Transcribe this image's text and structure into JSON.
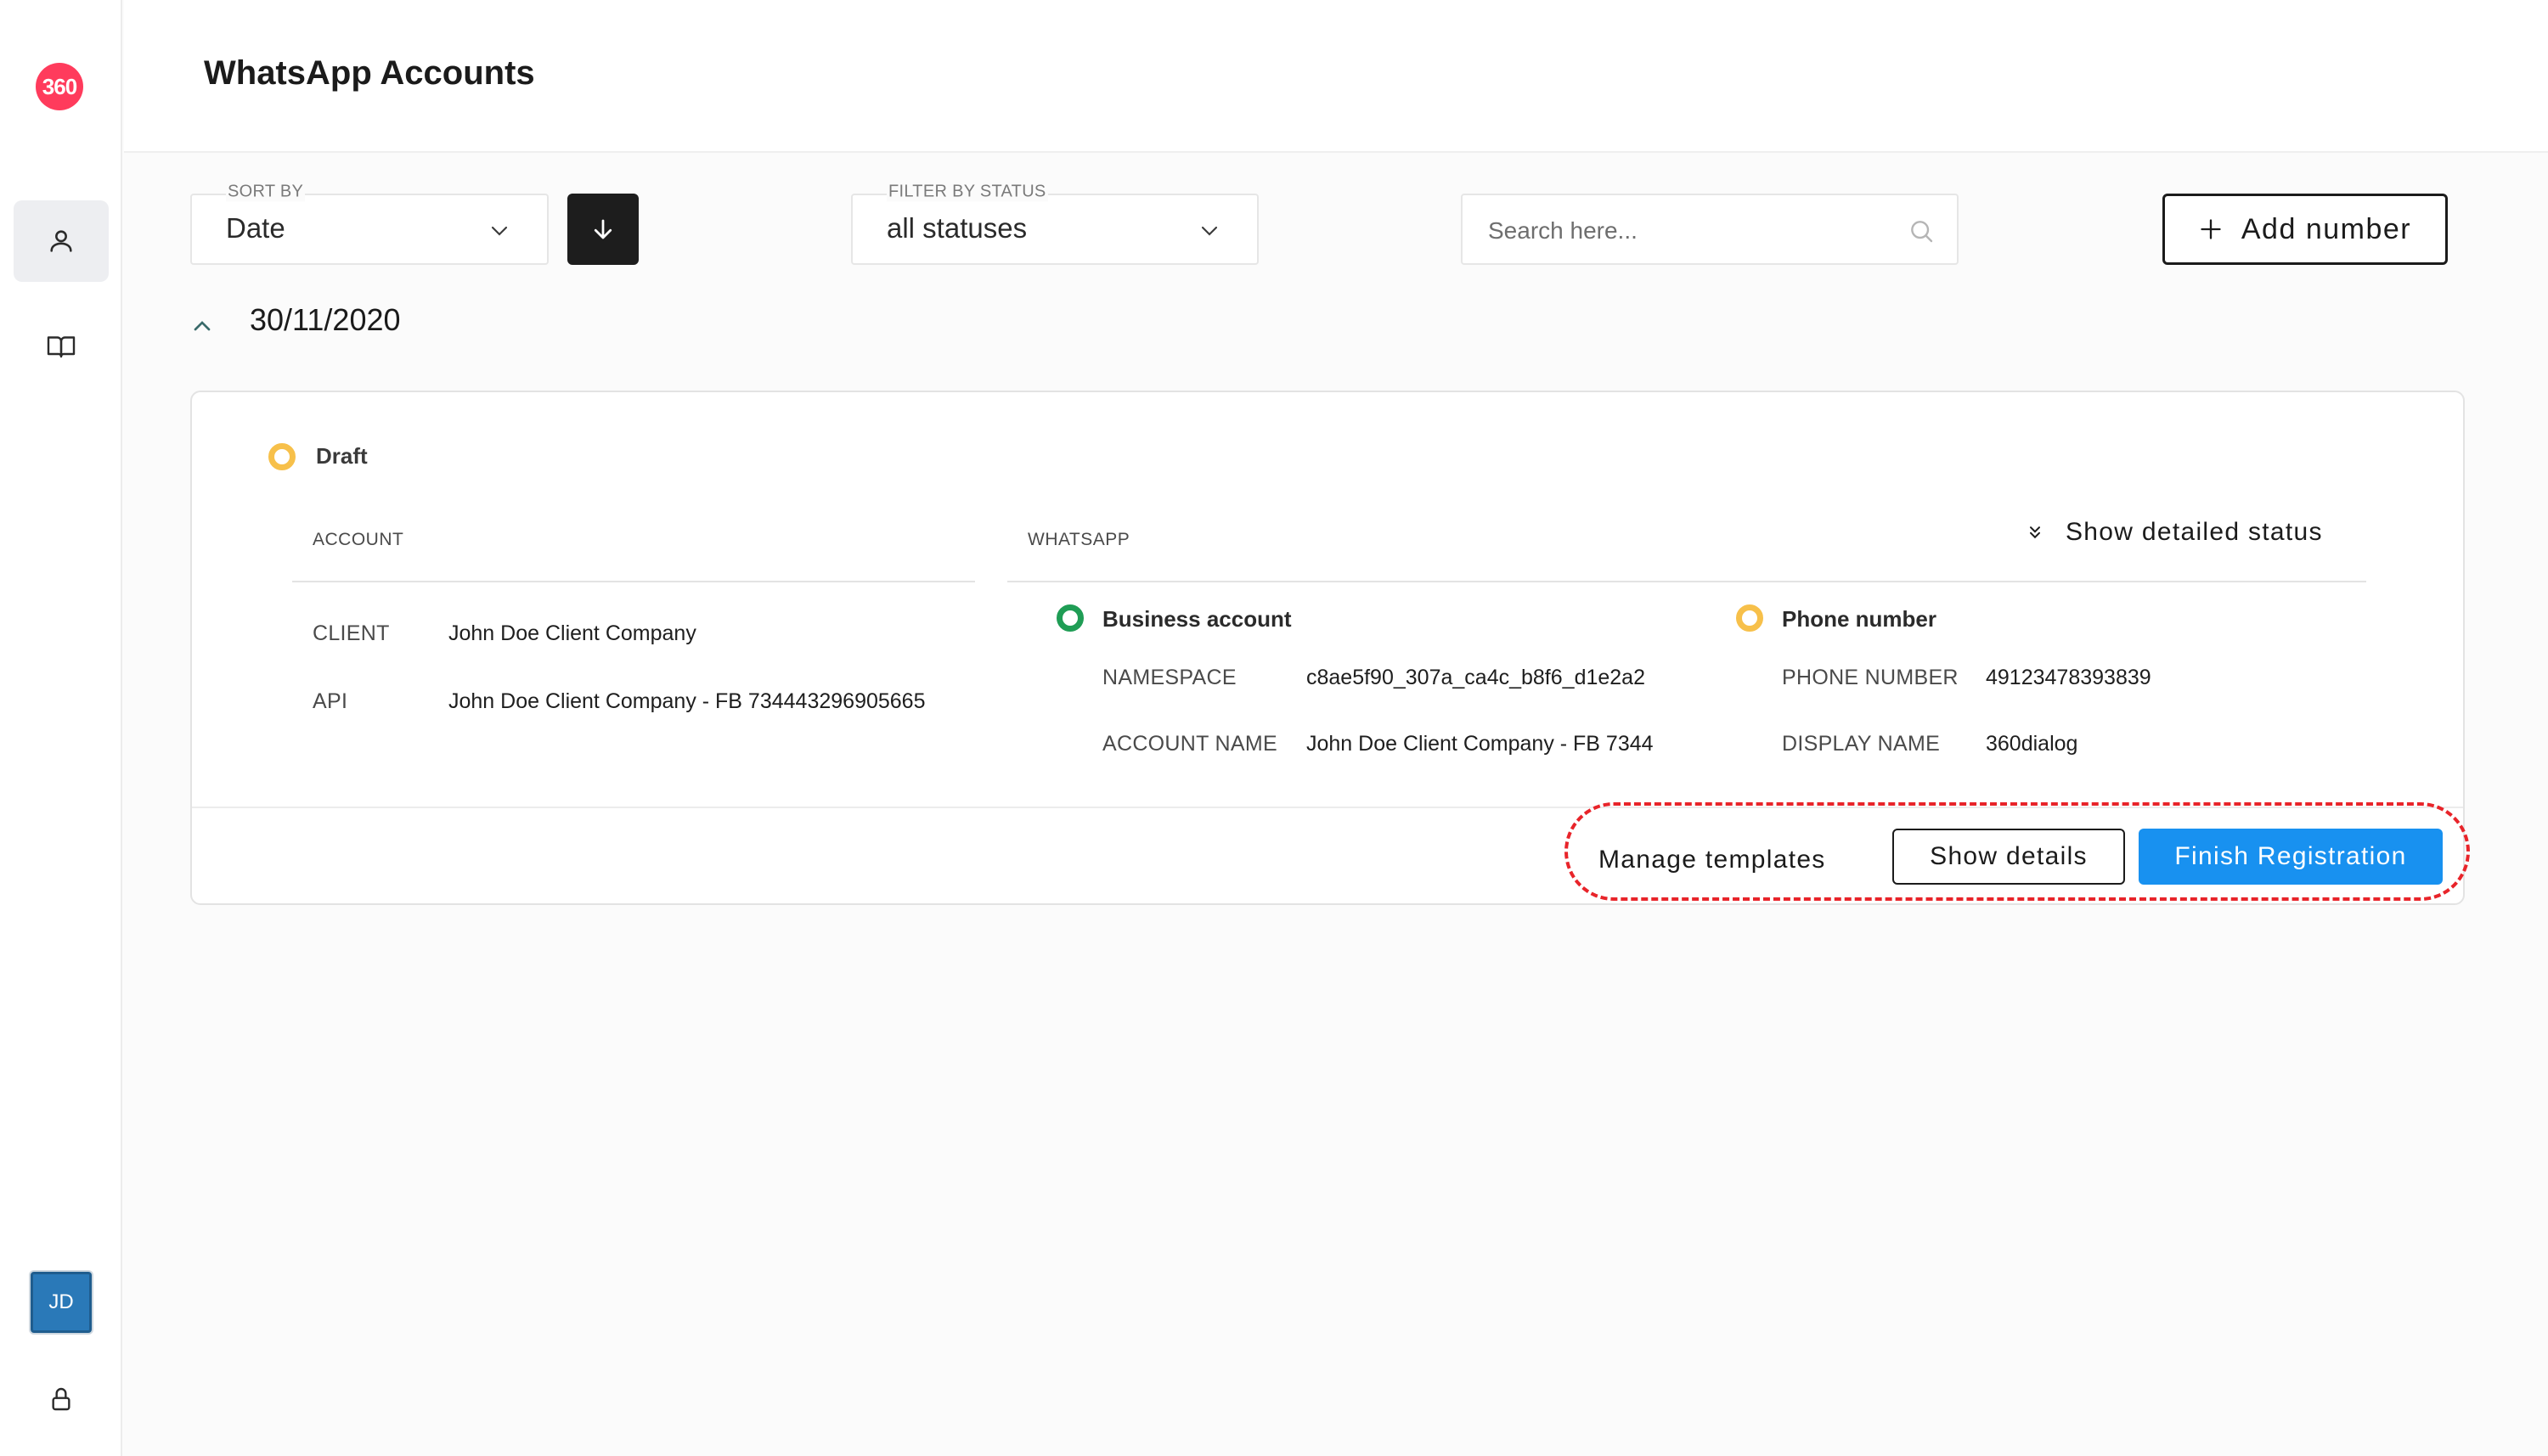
{
  "app": {
    "logo_text": "360",
    "brand_color": "#ff3b5c",
    "accent_color": "#1891f0"
  },
  "sidebar": {
    "items": [
      {
        "icon": "user-icon",
        "active": true
      },
      {
        "icon": "book-icon",
        "active": false
      }
    ],
    "avatar_initials": "JD",
    "bottom_icon": "lock-icon"
  },
  "header": {
    "title": "WhatsApp Accounts"
  },
  "filters": {
    "sort": {
      "label": "SORT BY",
      "value": "Date"
    },
    "sort_direction_icon": "arrow-down-icon",
    "status": {
      "label": "FILTER BY STATUS",
      "value": "all statuses"
    },
    "search": {
      "placeholder": "Search here..."
    },
    "add_button_label": "Add number"
  },
  "group": {
    "date": "30/11/2020",
    "expanded": true
  },
  "card": {
    "status_label": "Draft",
    "status_color": "#f7c04a",
    "account_heading": "ACCOUNT",
    "whatsapp_heading": "WHATSAPP",
    "show_detailed_status_label": "Show detailed status",
    "account": {
      "client_key": "CLIENT",
      "client_value": "John Doe Client Company",
      "api_key": "API",
      "api_value": "John Doe Client Company - FB 734443296905665"
    },
    "business_account": {
      "title": "Business account",
      "status_color": "#1f9d55",
      "namespace_key": "NAMESPACE",
      "namespace_value": "c8ae5f90_307a_ca4c_b8f6_d1e2a2",
      "account_name_key": "ACCOUNT NAME",
      "account_name_value": "John Doe Client Company - FB 7344"
    },
    "phone_number": {
      "title": "Phone number",
      "status_color": "#f7c04a",
      "phone_key": "PHONE NUMBER",
      "phone_value": "49123478393839",
      "display_name_key": "DISPLAY NAME",
      "display_name_value": "360dialog"
    },
    "actions": {
      "manage_templates": "Manage templates",
      "show_details": "Show details",
      "finish_registration": "Finish Registration"
    }
  }
}
